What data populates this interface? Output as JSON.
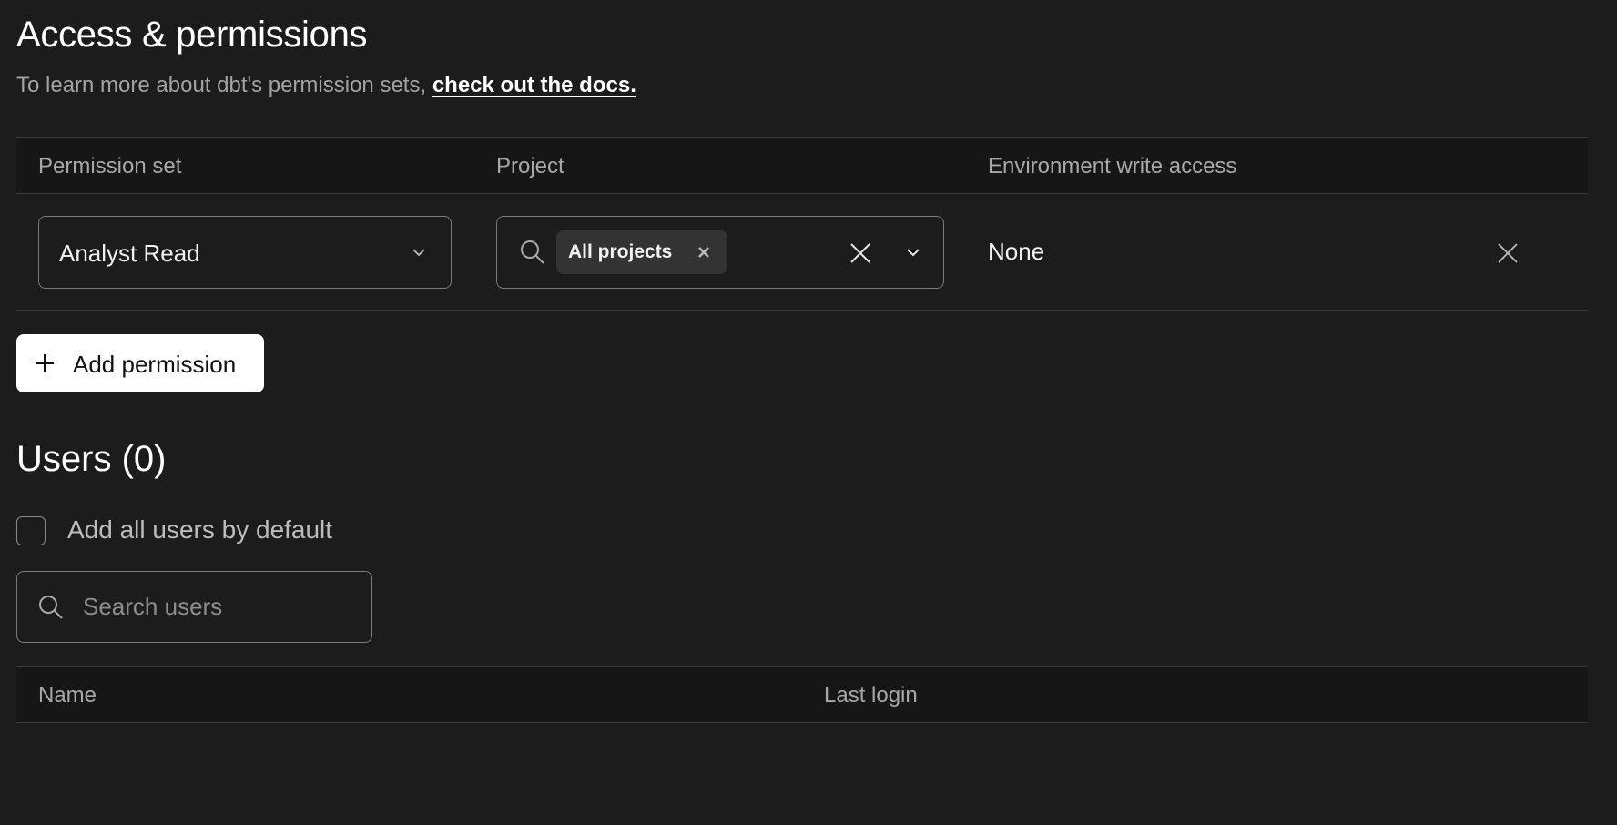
{
  "access": {
    "title": "Access & permissions",
    "intro_text": "To learn more about dbt's permission sets,",
    "docs_link": "check out the docs."
  },
  "permissions_table": {
    "headers": [
      "Permission set",
      "Project",
      "Environment write access"
    ],
    "rows": [
      {
        "permission_set": "Analyst Read",
        "project_tags": [
          "All projects"
        ],
        "environment_write_access": "None"
      }
    ],
    "add_button_label": "Add permission"
  },
  "users": {
    "title": "Users (0)",
    "add_all_label": "Add all users by default",
    "add_all_checked": false,
    "search_placeholder": "Search users",
    "table_headers": [
      "Name",
      "Last login"
    ]
  },
  "icons": [
    "chevron-down-icon",
    "search-icon",
    "close-icon",
    "plus-icon"
  ],
  "colors": {
    "background": "#1c1c1c",
    "header_bg": "#161616",
    "button_bg": "#ffffff"
  }
}
